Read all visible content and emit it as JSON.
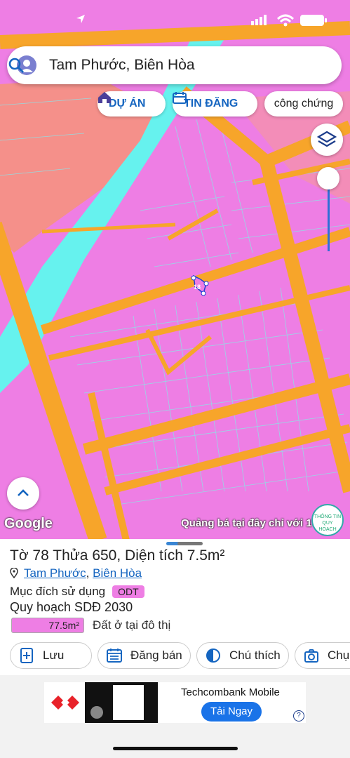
{
  "search": {
    "query": "Tam Phước, Biên Hòa"
  },
  "chips": [
    {
      "label": "DỰ ÁN",
      "icon": "house-icon"
    },
    {
      "label": "TIN ĐĂNG",
      "icon": "calendar-icon"
    },
    {
      "label": "công chứng"
    }
  ],
  "map": {
    "attribution": "Google",
    "ad_text": "Quảng bá tại đây chỉ với 1",
    "marker_label": "18",
    "info_badge": "THÔNG TIN QUY HOẠCH"
  },
  "parcel": {
    "title": "Tờ 78 Thửa 650, Diện tích 7.5m²",
    "location_ward": "Tam Phước",
    "location_city": "Biên Hòa",
    "location_sep": ", ",
    "purpose_label": "Mục đích sử dụng",
    "purpose_code": "ODT",
    "plan_label": "Quy hoạch SDĐ 2030",
    "plan_area": "77.5m²",
    "plan_desc": "Đất ở tại đô thị"
  },
  "actions": [
    {
      "label": "Lưu",
      "icon": "add-doc-icon"
    },
    {
      "label": "Đăng bán",
      "icon": "calendar-icon"
    },
    {
      "label": "Chú thích",
      "icon": "contrast-icon"
    },
    {
      "label": "Chụ",
      "icon": "camera-icon"
    }
  ],
  "ad": {
    "title": "Techcombank Mobile",
    "cta": "Tải Ngay",
    "info": "?"
  },
  "colors": {
    "residential": "#ee7ee4",
    "road": "#f7a52a",
    "river": "#66f2ee",
    "accent": "#1565c0"
  }
}
